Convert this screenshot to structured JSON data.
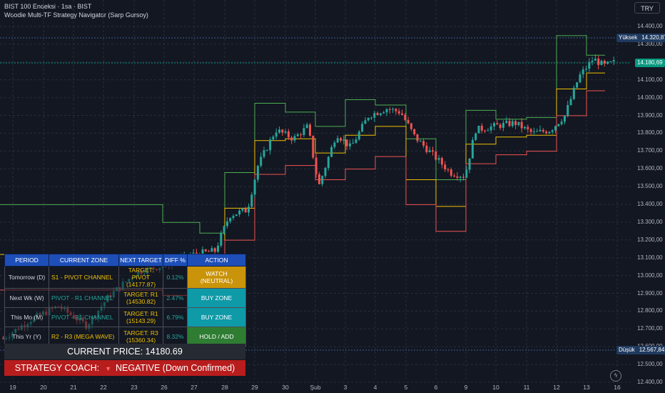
{
  "header": {
    "symbol_line": "BIST 100 Endeksi · 1sa · BIST",
    "indicator_line": "Woodie Multi-TF Strategy Navigator (Sarp Gursoy)",
    "currency": "TRY"
  },
  "price_scale": {
    "ticks": [
      "14.400,00",
      "14.300,00",
      "14.200,00",
      "14.100,00",
      "14.000,00",
      "13.900,00",
      "13.800,00",
      "13.700,00",
      "13.600,00",
      "13.500,00",
      "13.400,00",
      "13.300,00",
      "13.200,00",
      "13.100,00",
      "13.000,00",
      "12.900,00",
      "12.800,00",
      "12.700,00",
      "12.600,00",
      "12.500,00",
      "12.400,00"
    ],
    "high_label": "Yüksek",
    "high_value": "14.320,87",
    "last_value": "14.180,69",
    "low_label": "Düşük",
    "low_value": "12.567,84"
  },
  "time_scale": {
    "ticks": [
      "19",
      "20",
      "21",
      "22",
      "23",
      "26",
      "27",
      "28",
      "29",
      "30",
      "Şub",
      "3",
      "4",
      "5",
      "6",
      "9",
      "10",
      "11",
      "12",
      "13",
      "16"
    ]
  },
  "colors": {
    "up": "#26a69a",
    "down": "#ef5350",
    "r_line": "#4caf50",
    "pivot_line": "#f0c000",
    "s_line": "#ef5350"
  },
  "table": {
    "headers": [
      "PERIOD",
      "CURRENT ZONE",
      "NEXT TARGET",
      "DIFF %",
      "ACTION"
    ],
    "rows": [
      {
        "period": "Tomorrow (D)",
        "zone": "S1 - PIVOT CHANNEL",
        "zone_color": "#f0c000",
        "target_l1": "TARGET: PIVOT",
        "target_l2": "(14177.87)",
        "diff": "0.12%",
        "action": "WATCH (NEUTRAL)",
        "action_color": "#c9940a"
      },
      {
        "period": "Next Wk (W)",
        "zone": "PIVOT - R1 CHANNEL",
        "zone_color": "#26a69a",
        "target_l1": "TARGET: R1",
        "target_l2": "(14530.82)",
        "diff": "2.47%",
        "action": "BUY ZONE",
        "action_color": "#0f9aa8"
      },
      {
        "period": "This Mo (M)",
        "zone": "PIVOT - R1 CHANNEL",
        "zone_color": "#26a69a",
        "target_l1": "TARGET: R1",
        "target_l2": "(15143.29)",
        "diff": "6.79%",
        "action": "BUY ZONE",
        "action_color": "#0f9aa8"
      },
      {
        "period": "This Yr (Y)",
        "zone": "R2 - R3 (MEGA WAVE)",
        "zone_color": "#f0c000",
        "target_l1": "TARGET: R3",
        "target_l2": "(15360.34)",
        "diff": "8.32%",
        "action": "HOLD / ADD",
        "action_color": "#2e7d32"
      }
    ]
  },
  "current_price": "CURRENT PRICE: 14180.69",
  "coach": {
    "label": "STRATEGY COACH:",
    "icon": "triangle-down-icon",
    "status": "NEGATIVE (Down Confirmed)"
  }
}
